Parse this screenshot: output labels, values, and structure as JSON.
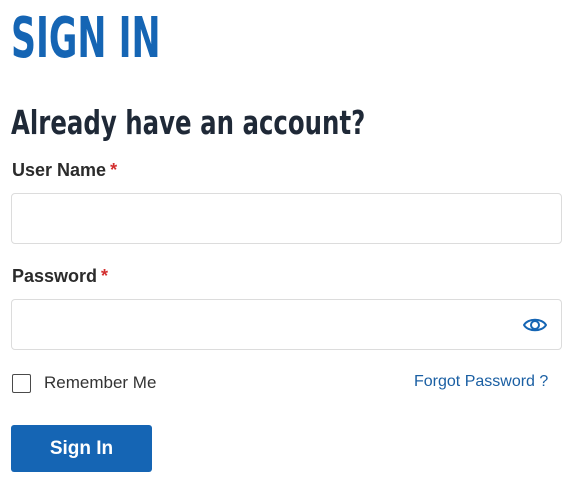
{
  "page": {
    "title": "SIGN IN",
    "subheading": "Already have an account?"
  },
  "form": {
    "username": {
      "label": "User Name",
      "required_mark": "*",
      "value": "",
      "placeholder": ""
    },
    "password": {
      "label": "Password",
      "required_mark": "*",
      "value": "",
      "placeholder": "",
      "toggle_icon": "eye-icon"
    },
    "remember": {
      "label": "Remember Me",
      "checked": false
    },
    "forgot_label": "Forgot Password ?",
    "submit_label": "Sign In"
  },
  "colors": {
    "brand": "#1565b4",
    "required": "#d32f2f",
    "link": "#1a5fa3",
    "heading": "#1f2937"
  }
}
